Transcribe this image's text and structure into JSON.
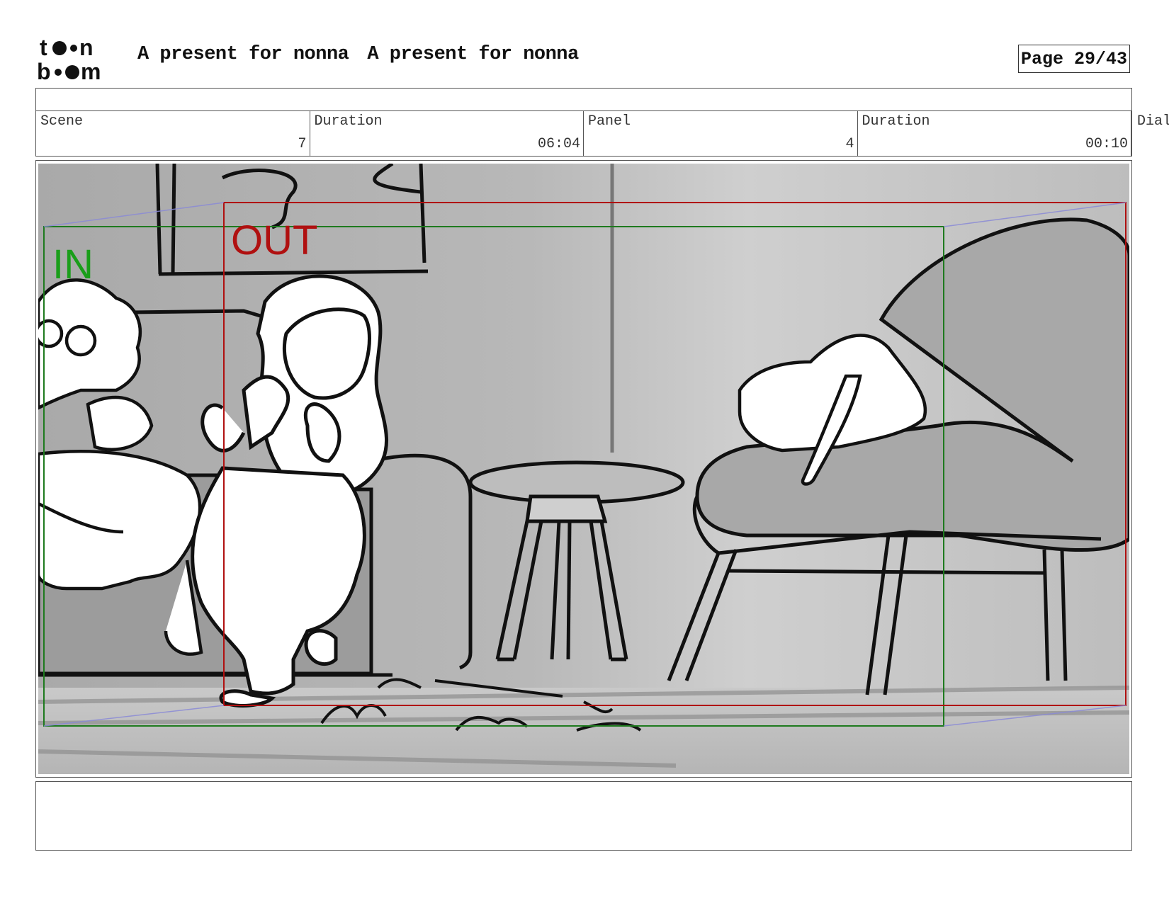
{
  "header": {
    "logo_alt": "toon boom",
    "title_left": "A present for nonna",
    "title_right": "A present for nonna",
    "page_label": "Page 29/43"
  },
  "info": {
    "scene_label": "Scene",
    "scene_value": "7",
    "scene_duration_label": "Duration",
    "scene_duration_value": "06:04",
    "panel_label": "Panel",
    "panel_value": "4",
    "panel_duration_label": "Duration",
    "panel_duration_value": "00:10",
    "dialog_label": "Dial"
  },
  "panel_image": {
    "in_label": "IN",
    "out_label": "OUT",
    "in_color": "#1a9e1a",
    "out_color": "#b01010"
  },
  "notes": {
    "text": ""
  }
}
